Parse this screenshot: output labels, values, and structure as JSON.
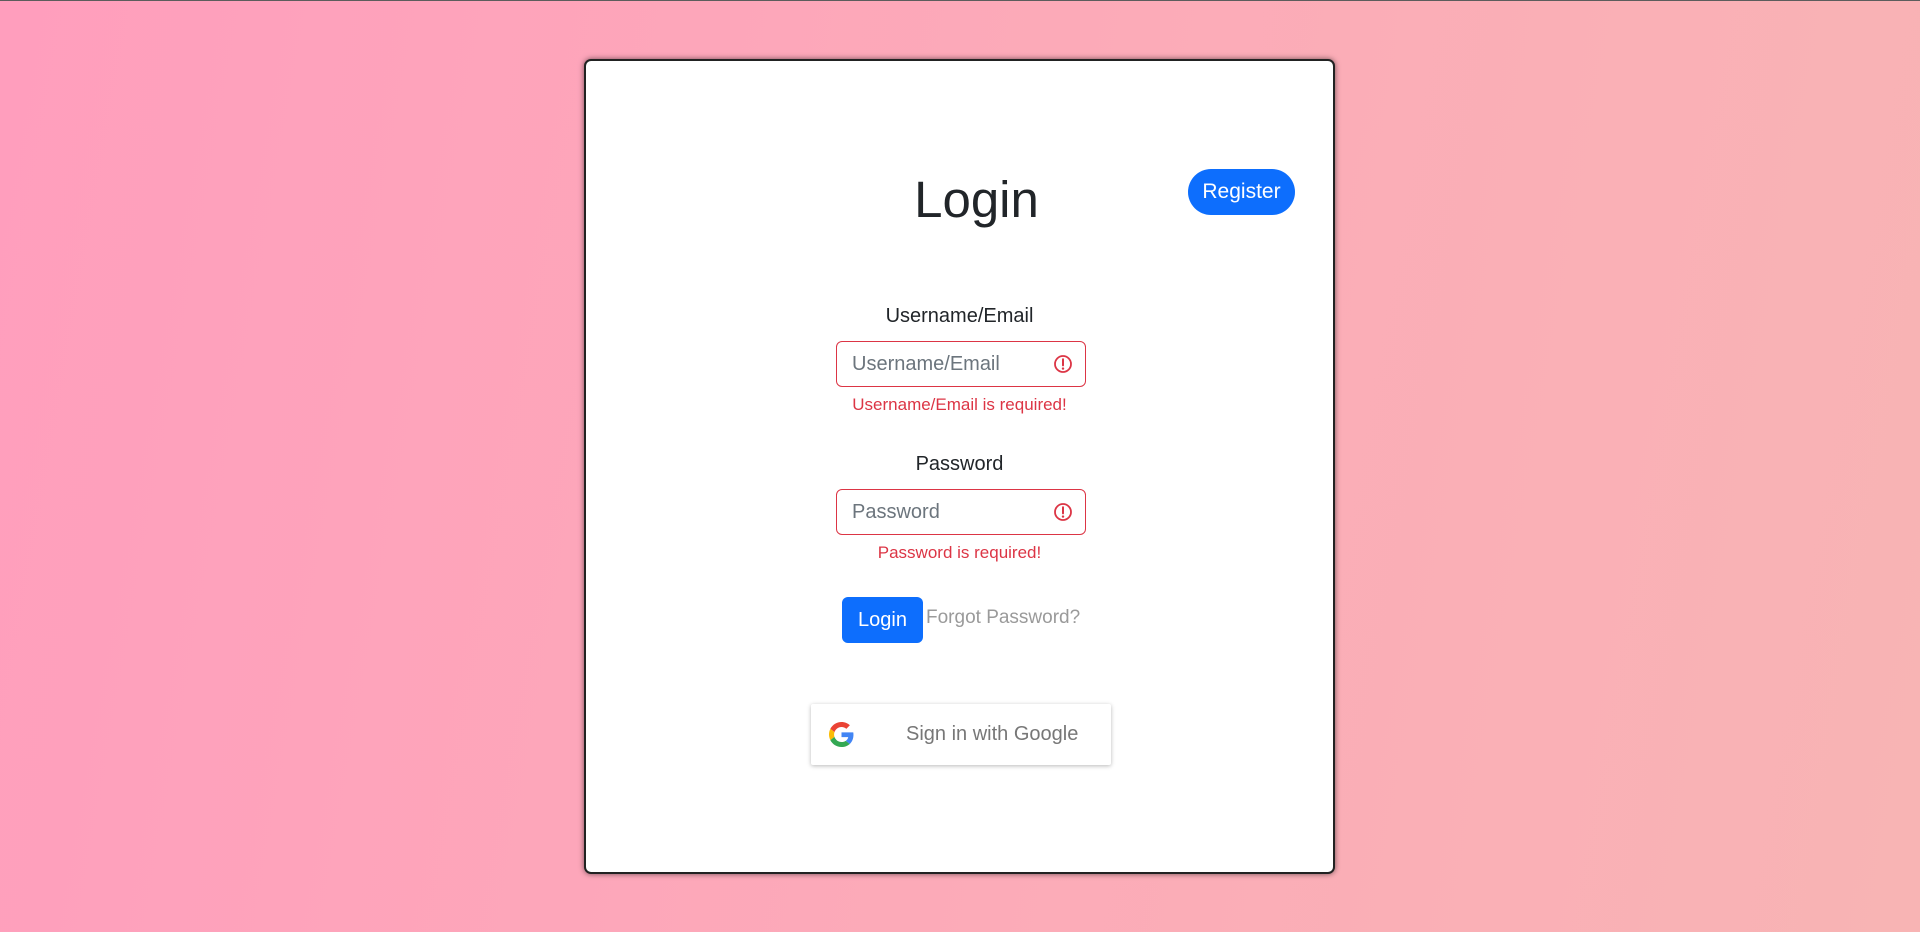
{
  "card": {
    "title": "Login",
    "register_label": "Register"
  },
  "form": {
    "username": {
      "label": "Username/Email",
      "placeholder": "Username/Email",
      "value": "",
      "error": "Username/Email is required!"
    },
    "password": {
      "label": "Password",
      "placeholder": "Password",
      "value": "",
      "error": "Password is required!"
    },
    "login_label": "Login",
    "forgot_label": "Forgot Password?"
  },
  "google": {
    "label": "Sign in with Google",
    "icon": "google-g-icon"
  },
  "icons": {
    "field_error": "exclamation-circle-icon"
  },
  "colors": {
    "primary": "#0d6efd",
    "danger": "#dc3545",
    "text": "#212529",
    "muted_link": "#9a9a9a"
  }
}
